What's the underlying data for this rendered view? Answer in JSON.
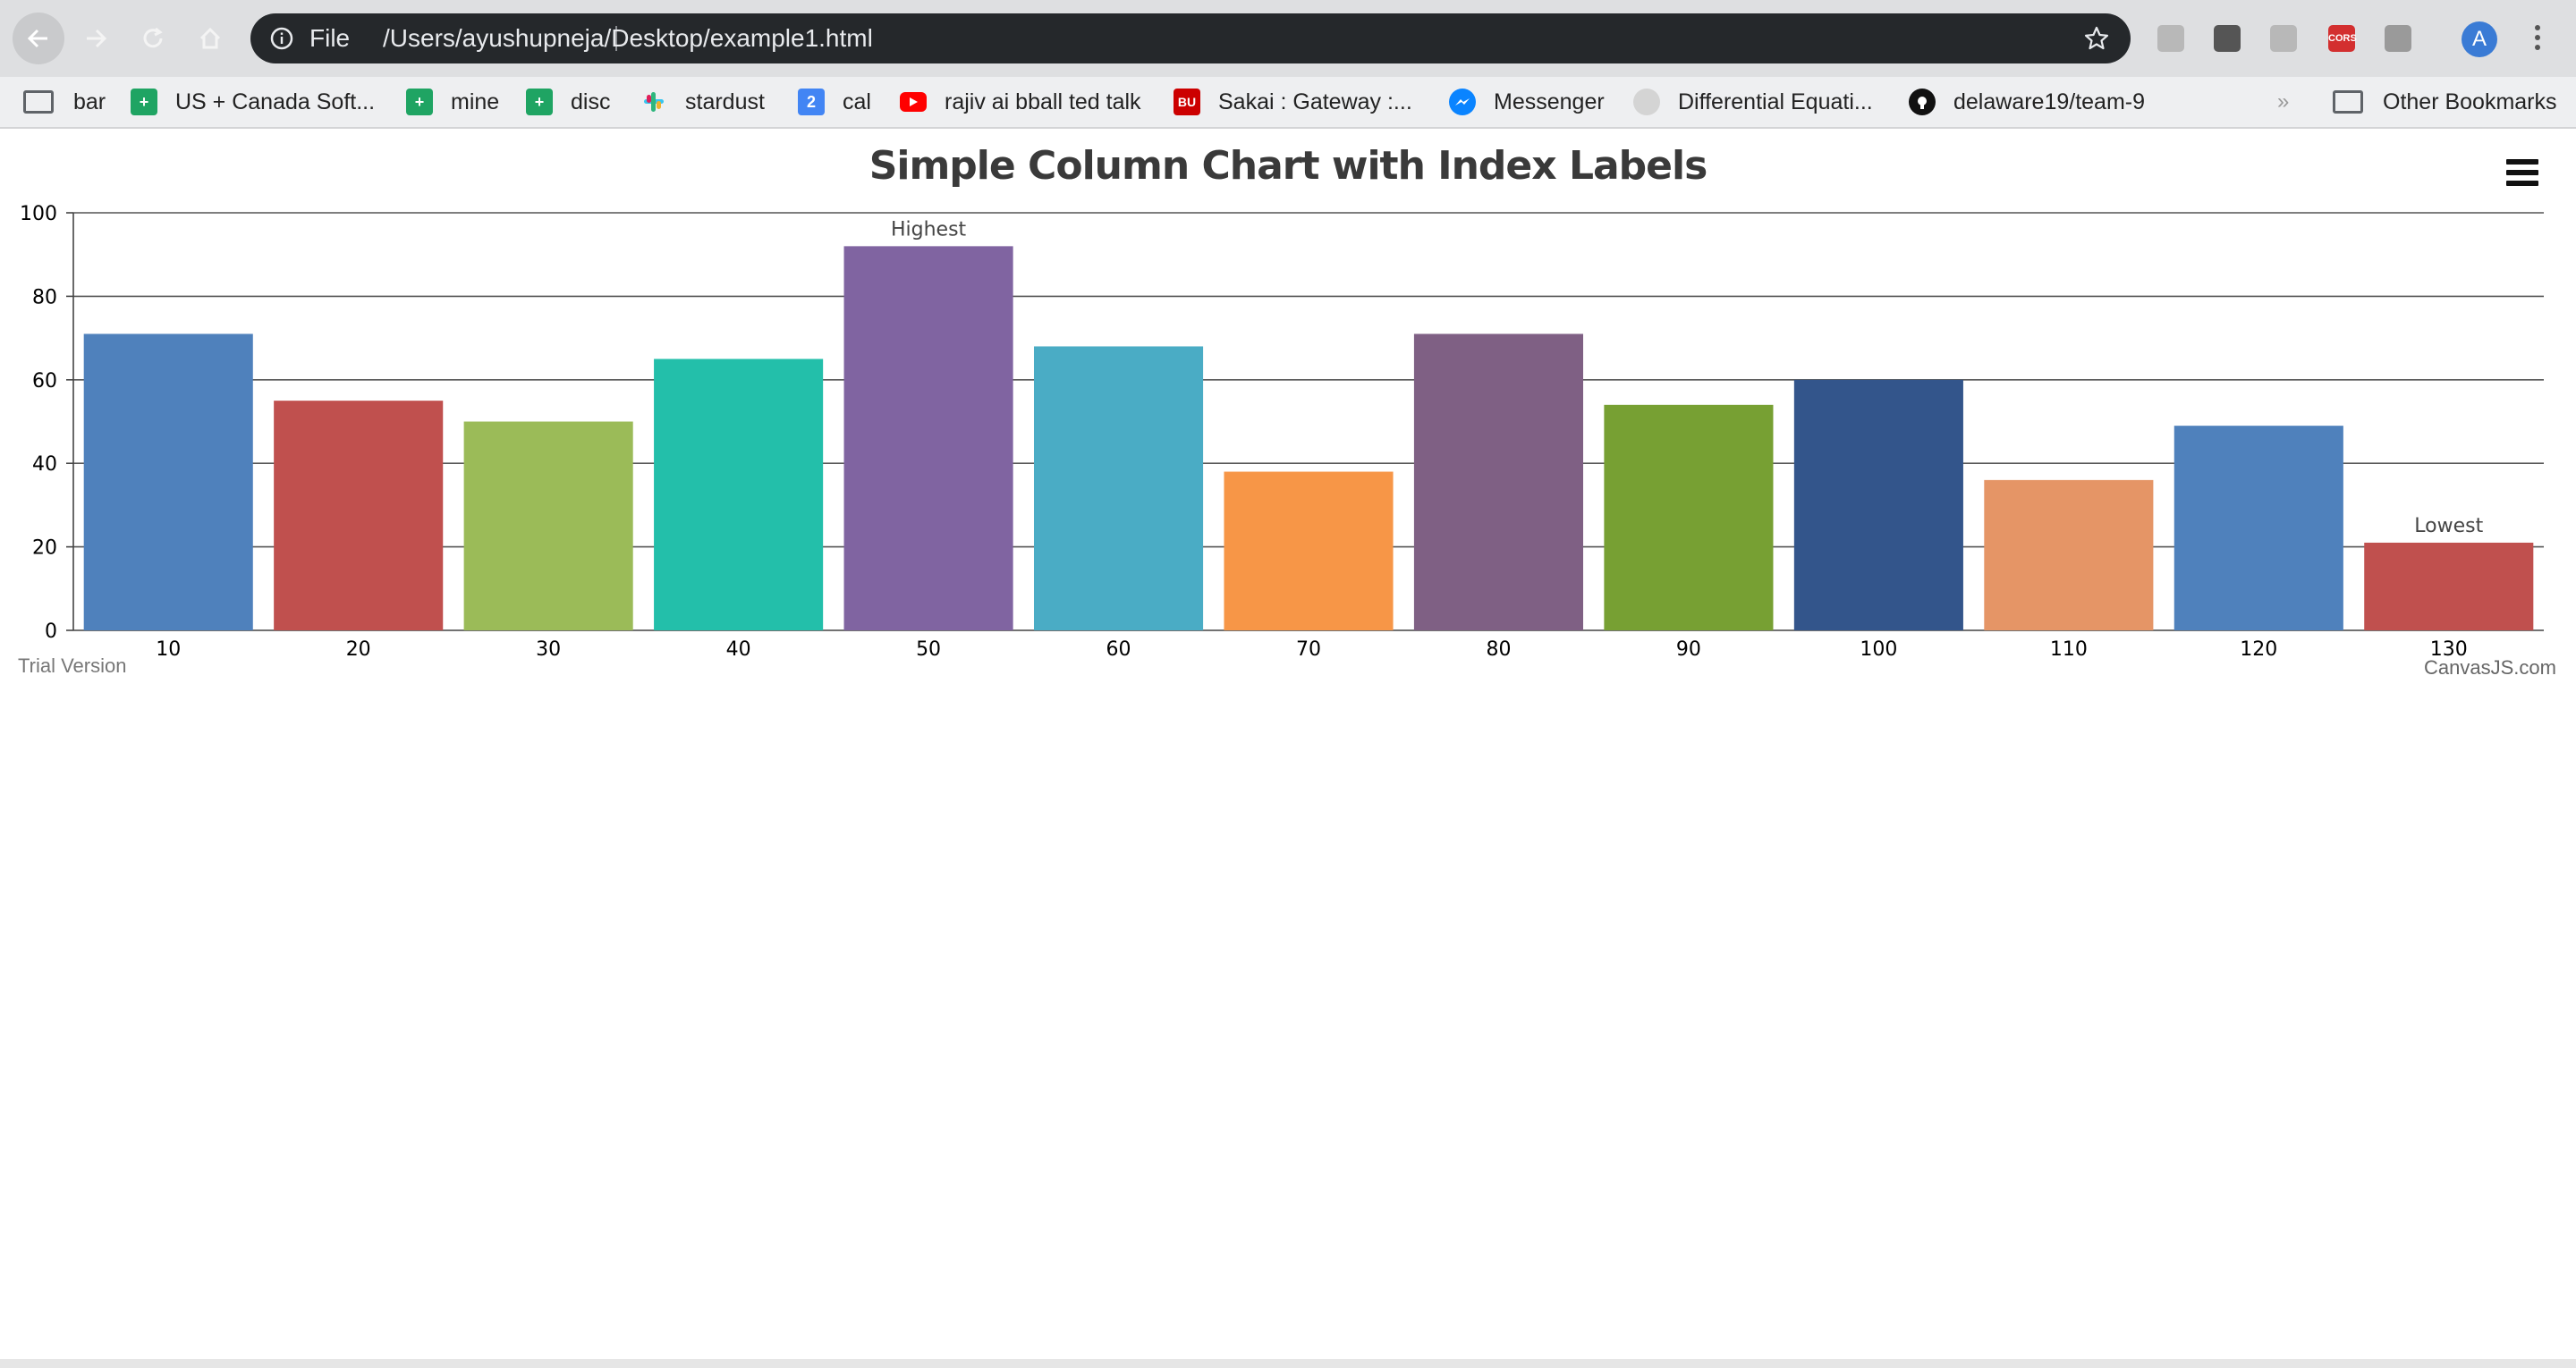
{
  "browser": {
    "address_scheme": "File",
    "address_url": "/Users/ayushupneja/Desktop/example1.html",
    "avatar_letter": "A",
    "extensions": [
      {
        "name": "fx-extension-icon",
        "color": "#b8b8b8"
      },
      {
        "name": "download-extension-icon",
        "color": "#555555"
      },
      {
        "name": "copy-extension-icon",
        "color": "#b8b8b8"
      },
      {
        "name": "cors-extension-icon",
        "color": "#d32f2f",
        "label": "CORS"
      },
      {
        "name": "mail-extension-icon",
        "color": "#9a9a9a"
      }
    ]
  },
  "bookmarks": {
    "items": [
      {
        "label": "bar",
        "icon": "folder-icon",
        "color": "#5f6368"
      },
      {
        "label": "US + Canada Soft...",
        "icon": "sheets-icon",
        "color": "#1fa463"
      },
      {
        "label": "mine",
        "icon": "sheets-icon",
        "color": "#1fa463"
      },
      {
        "label": "disc",
        "icon": "sheets-icon",
        "color": "#1fa463"
      },
      {
        "label": "stardust",
        "icon": "slack-icon",
        "color": "#e01e5a"
      },
      {
        "label": "cal",
        "icon": "calendar-icon",
        "color": "#4285f4",
        "glyph": "2"
      },
      {
        "label": "rajiv ai bball ted talk",
        "icon": "youtube-icon",
        "color": "#ff0000"
      },
      {
        "label": "Sakai : Gateway :...",
        "icon": "bu-icon",
        "color": "#cc0000",
        "glyph": "BU"
      },
      {
        "label": "Messenger",
        "icon": "messenger-icon",
        "color": "#0a84ff"
      },
      {
        "label": "Differential Equati...",
        "icon": "globe-icon",
        "color": "#cfcfcf"
      },
      {
        "label": "delaware19/team-9",
        "icon": "github-icon",
        "color": "#111111"
      }
    ],
    "overflow": "»",
    "other_label": "Other Bookmarks"
  },
  "chart": {
    "trial_text": "Trial Version",
    "credit_text": "CanvasJS.com"
  },
  "chart_data": {
    "type": "bar",
    "title": "Simple Column Chart with Index Labels",
    "xlabel": "",
    "ylabel": "",
    "ylim": [
      0,
      100
    ],
    "yticks": [
      0,
      20,
      40,
      60,
      80,
      100
    ],
    "grid": true,
    "categories": [
      10,
      20,
      30,
      40,
      50,
      60,
      70,
      80,
      90,
      100,
      110,
      120,
      130
    ],
    "values": [
      71,
      55,
      50,
      65,
      92,
      68,
      38,
      71,
      54,
      60,
      36,
      49,
      21
    ],
    "index_labels": {
      "50": "Highest",
      "130": "Lowest"
    },
    "colors": [
      "#4f81bc",
      "#c0504e",
      "#9bbb58",
      "#23bfaa",
      "#8064a1",
      "#4aacc5",
      "#f79647",
      "#7f6084",
      "#77a033",
      "#33558b",
      "#e59566",
      "#4f81bc",
      "#c0504e"
    ]
  }
}
